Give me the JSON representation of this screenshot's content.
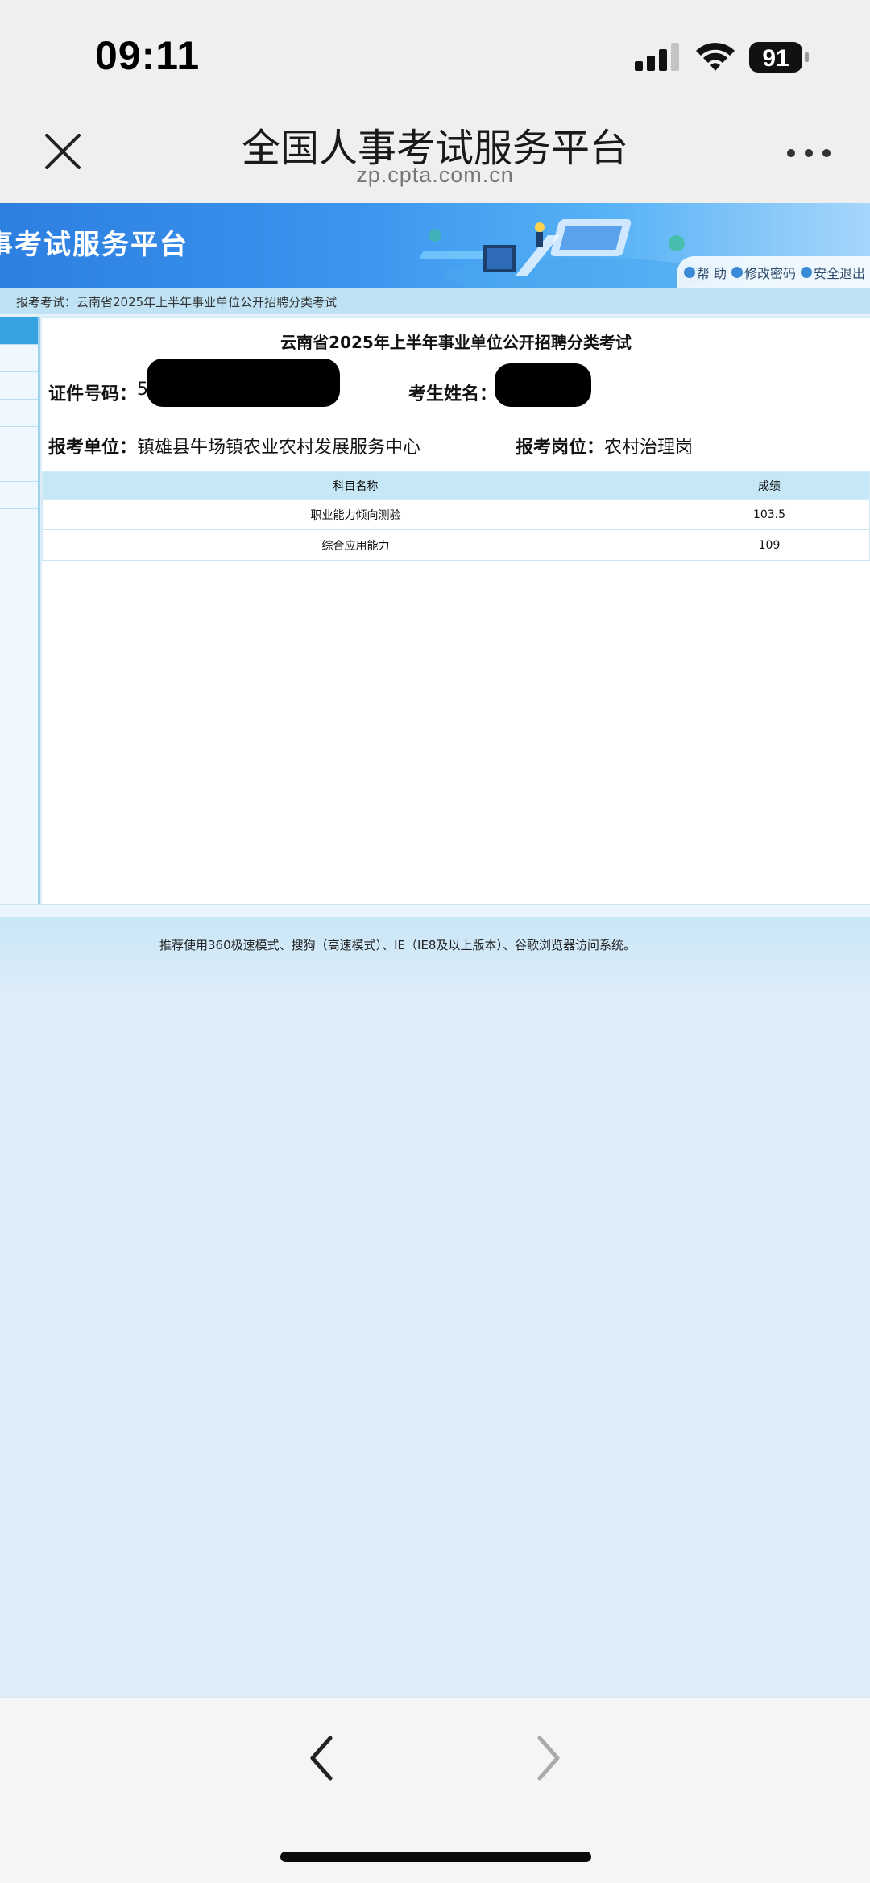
{
  "status_bar": {
    "time": "09:11",
    "battery": "91",
    "icons": [
      "signal-icon",
      "wifi-icon",
      "battery-icon"
    ]
  },
  "browser": {
    "title": "全国人事考试服务平台",
    "url": "zp.cpta.com.cn",
    "icons": [
      "close-icon",
      "more-icon",
      "back-arrow-icon",
      "forward-arrow-icon"
    ]
  },
  "site": {
    "banner_title": "事考试服务平台",
    "tools": {
      "help": "帮 助",
      "change_password": "修改密码",
      "logout": "安全退出"
    },
    "breadcrumb": "报考考试：云南省2025年上半年事业单位公开招聘分类考试"
  },
  "exam": {
    "title": "云南省2025年上半年事业单位公开招聘分类考试",
    "id_label": "证件号码：",
    "id_value": "5",
    "name_label": "考生姓名：",
    "unit_label": "报考单位：",
    "unit_value": "镇雄县牛场镇农业农村发展服务中心",
    "position_label": "报考岗位：",
    "position_value": "农村治理岗"
  },
  "scores": {
    "headers": {
      "subject": "科目名称",
      "score": "成绩"
    },
    "rows": [
      {
        "subject": "职业能力倾向测验",
        "score": "103.5"
      },
      {
        "subject": "综合应用能力",
        "score": "109"
      }
    ]
  },
  "footer": {
    "notice": "推荐使用360极速模式、搜狗（高速模式）、IE（IE8及以上版本）、谷歌浏览器访问系统。"
  },
  "colors": {
    "banner_blue": "#2d7fe0",
    "breadcrumb_bg": "#bfe3f4",
    "table_header_bg": "#c5e7f6",
    "page_bg": "#dcecf9"
  }
}
